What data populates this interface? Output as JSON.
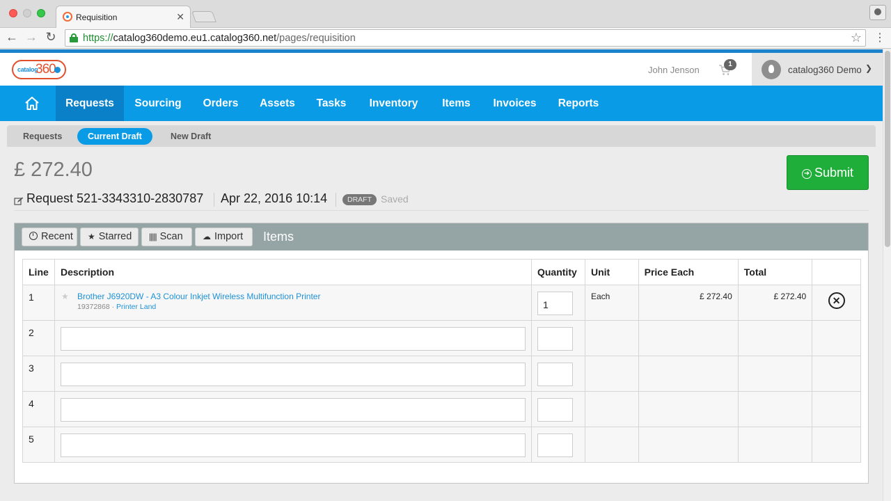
{
  "browser": {
    "tab_title": "Requisition",
    "url_scheme": "https://",
    "url_domain": "catalog360demo.eu1.catalog360.net",
    "url_path": "/pages/requisition"
  },
  "header": {
    "logo_small": "catalog",
    "logo_num": "360",
    "user_name": "John Jenson",
    "cart_count": "1",
    "account_name": "catalog360 Demo"
  },
  "nav": {
    "items": [
      "Requests",
      "Sourcing",
      "Orders",
      "Assets",
      "Tasks",
      "Inventory",
      "Items",
      "Invoices",
      "Reports"
    ],
    "active": "Requests"
  },
  "subnav": {
    "items": [
      "Requests",
      "Current Draft",
      "New Draft"
    ],
    "active": "Current Draft"
  },
  "requisition": {
    "total": "£ 272.40",
    "submit_label": "Submit",
    "request_label": "Request 521-3343310-2830787",
    "date": "Apr 22, 2016 10:14",
    "status_badge": "DRAFT",
    "save_state": "Saved"
  },
  "items_panel": {
    "title": "Items",
    "buttons": {
      "recent": "Recent",
      "starred": "Starred",
      "scan": "Scan",
      "import": "Import"
    },
    "columns": [
      "Line",
      "Description",
      "Quantity",
      "Unit",
      "Price Each",
      "Total",
      ""
    ],
    "rows": [
      {
        "line": "1",
        "description": "Brother J6920DW - A3 Colour Inkjet Wireless Multifunction Printer",
        "code": "19372868",
        "supplier": "Printer Land",
        "quantity": "1",
        "unit": "Each",
        "price_each": "£ 272.40",
        "total": "£ 272.40"
      },
      {
        "line": "2"
      },
      {
        "line": "3"
      },
      {
        "line": "4"
      },
      {
        "line": "5"
      }
    ]
  },
  "colors": {
    "brand_blue": "#0a9be6",
    "active_nav": "#0a80c8",
    "submit_green": "#1fae3a",
    "logo_orange": "#e2502c"
  }
}
